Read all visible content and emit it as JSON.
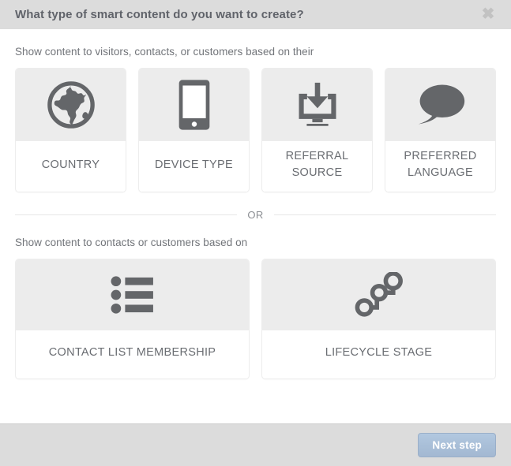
{
  "header": {
    "title": "What type of smart content do you want to create?",
    "close_icon": "close-icon",
    "close_glyph": "✖"
  },
  "body": {
    "section_one_label": "Show content to visitors, contacts, or customers based on their",
    "divider_text": "OR",
    "section_two_label": "Show content to contacts or customers based on"
  },
  "cards_primary": [
    {
      "label": "COUNTRY",
      "icon": "globe-icon"
    },
    {
      "label": "DEVICE TYPE",
      "icon": "mobile-phone-icon"
    },
    {
      "label": "REFERRAL SOURCE",
      "icon": "download-to-monitor-icon"
    },
    {
      "label": "PREFERRED LANGUAGE",
      "icon": "speech-bubble-icon"
    }
  ],
  "cards_secondary": [
    {
      "label": "CONTACT LIST MEMBERSHIP",
      "icon": "bulleted-list-icon"
    },
    {
      "label": "LIFECYCLE STAGE",
      "icon": "connected-nodes-icon"
    }
  ],
  "footer": {
    "next_label": "Next step"
  },
  "colors": {
    "header_bg": "#dcdcdc",
    "footer_bg": "#dcdcdc",
    "body_bg": "#ffffff",
    "card_icon_bg": "#ececec",
    "card_border": "#ededed",
    "icon_fill": "#646669",
    "text": "#6a6d72",
    "button_bg": "#a9bfd8",
    "button_text": "#ffffff"
  }
}
